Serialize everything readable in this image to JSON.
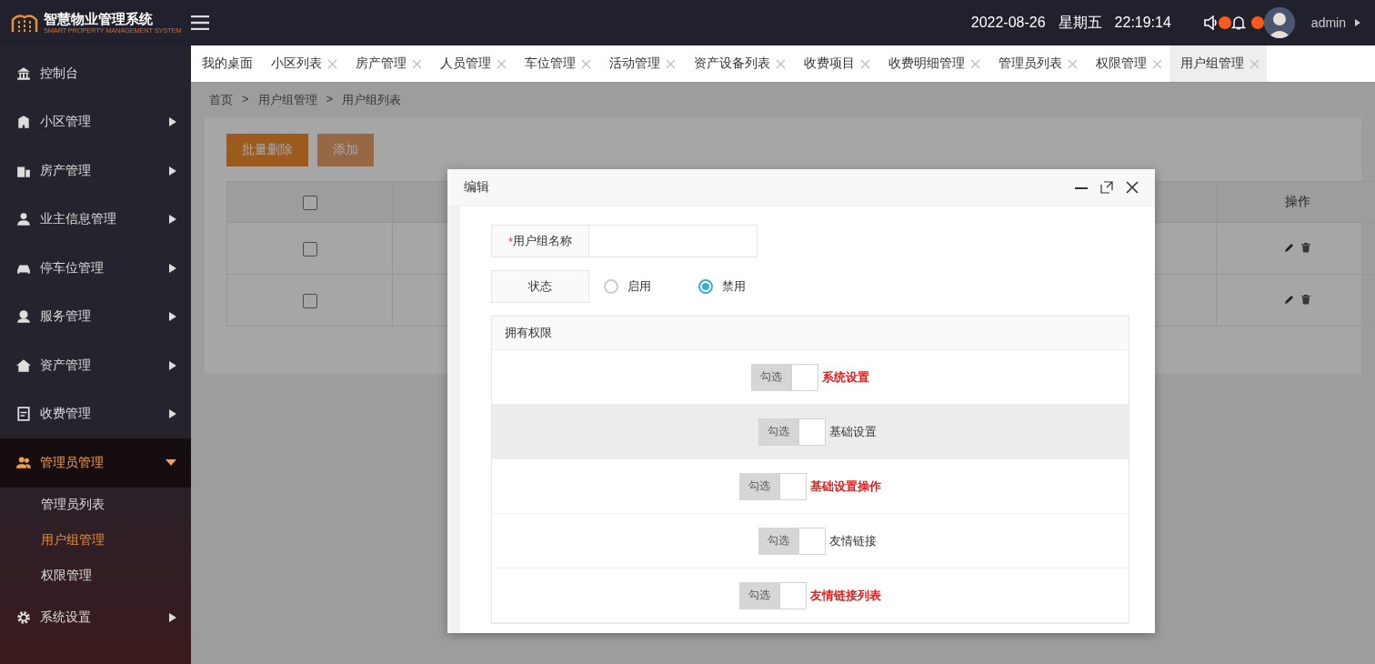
{
  "header": {
    "logo_title": "智慧物业管理系统",
    "logo_subtitle": "SMART PROPERTY MANAGEMENT SYSTEM",
    "date": "2022-08-26",
    "weekday": "星期五",
    "time": "22:19:14",
    "user": "admin"
  },
  "sidebar": {
    "items": [
      {
        "label": "控制台",
        "kind": "link",
        "expanded": false
      },
      {
        "label": "小区管理",
        "kind": "menu",
        "expanded": false
      },
      {
        "label": "房产管理",
        "kind": "menu",
        "expanded": false
      },
      {
        "label": "业主信息管理",
        "kind": "menu",
        "expanded": false
      },
      {
        "label": "停车位管理",
        "kind": "menu",
        "expanded": false
      },
      {
        "label": "服务管理",
        "kind": "menu",
        "expanded": false
      },
      {
        "label": "资产管理",
        "kind": "menu",
        "expanded": false
      },
      {
        "label": "收费管理",
        "kind": "menu",
        "expanded": false
      },
      {
        "label": "管理员管理",
        "kind": "menu",
        "expanded": true,
        "children": [
          {
            "label": "管理员列表",
            "selected": false
          },
          {
            "label": "用户组管理",
            "selected": true
          },
          {
            "label": "权限管理",
            "selected": false
          }
        ]
      },
      {
        "label": "系统设置",
        "kind": "menu",
        "expanded": false
      }
    ]
  },
  "tabs": [
    {
      "label": "我的桌面",
      "closable": false,
      "selected": false
    },
    {
      "label": "小区列表",
      "closable": true,
      "selected": false
    },
    {
      "label": "房产管理",
      "closable": true,
      "selected": false
    },
    {
      "label": "人员管理",
      "closable": true,
      "selected": false
    },
    {
      "label": "车位管理",
      "closable": true,
      "selected": false
    },
    {
      "label": "活动管理",
      "closable": true,
      "selected": false
    },
    {
      "label": "资产设备列表",
      "closable": true,
      "selected": false
    },
    {
      "label": "收费项目",
      "closable": true,
      "selected": false
    },
    {
      "label": "收费明细管理",
      "closable": true,
      "selected": false
    },
    {
      "label": "管理员列表",
      "closable": true,
      "selected": false
    },
    {
      "label": "权限管理",
      "closable": true,
      "selected": false
    },
    {
      "label": "用户组管理",
      "closable": true,
      "selected": true
    }
  ],
  "breadcrumb": [
    "首页",
    "用户组管理",
    "用户组列表"
  ],
  "breadcrumb_separator": ">",
  "toolbar": {
    "delete_button": "批量删除",
    "add_button": "添加"
  },
  "table": {
    "action_column": "操作",
    "header_checked": false,
    "rows": [
      {
        "checked": false
      },
      {
        "checked": false
      }
    ]
  },
  "dialog": {
    "title": "编辑",
    "name_field": {
      "required_mark": "*",
      "label": "用户组名称"
    },
    "status_field": {
      "label": "状态",
      "options": [
        {
          "label": "启用",
          "selected": false
        },
        {
          "label": "禁用",
          "selected": true
        }
      ]
    },
    "permissions": {
      "title": "拥有权限",
      "rows": [
        {
          "switch_text": "勾选",
          "checked": false,
          "label": "系统设置",
          "kind": "group",
          "hovered": false
        },
        {
          "switch_text": "勾选",
          "checked": false,
          "label": "基础设置",
          "kind": "item",
          "hovered": true
        },
        {
          "switch_text": "勾选",
          "checked": false,
          "label": "基础设置操作",
          "kind": "group",
          "hovered": false
        },
        {
          "switch_text": "勾选",
          "checked": false,
          "label": "友情链接",
          "kind": "item",
          "hovered": false
        },
        {
          "switch_text": "勾选",
          "checked": false,
          "label": "友情链接列表",
          "kind": "group",
          "hovered": false
        }
      ]
    }
  }
}
